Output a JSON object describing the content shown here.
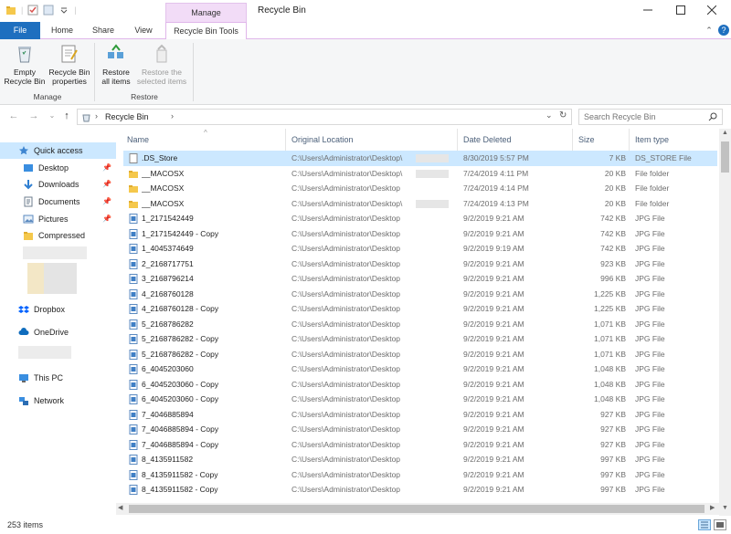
{
  "window": {
    "title": "Recycle Bin",
    "contextual_group": "Manage",
    "minimize_icon": "minimize-icon",
    "maximize_icon": "maximize-icon",
    "close_icon": "close-icon"
  },
  "ribbon": {
    "tabs": [
      {
        "label": "File"
      },
      {
        "label": "Home"
      },
      {
        "label": "Share"
      },
      {
        "label": "View"
      },
      {
        "label": "Recycle Bin Tools"
      }
    ],
    "buttons": {
      "empty": "Empty Recycle Bin",
      "properties": "Recycle Bin properties",
      "restore_all": "Restore all items",
      "restore_selected": "Restore the selected items"
    },
    "groups": {
      "manage": "Manage",
      "restore": "Restore"
    }
  },
  "nav": {
    "address": "Recycle Bin",
    "search_placeholder": "Search Recycle Bin"
  },
  "sidebar": {
    "quick_access": "Quick access",
    "items": [
      {
        "label": "Desktop"
      },
      {
        "label": "Downloads"
      },
      {
        "label": "Documents"
      },
      {
        "label": "Pictures"
      },
      {
        "label": "Compressed"
      }
    ],
    "dropbox": "Dropbox",
    "onedrive": "OneDrive",
    "this_pc": "This PC",
    "network": "Network"
  },
  "columns": {
    "name": "Name",
    "original_location": "Original Location",
    "date_deleted": "Date Deleted",
    "size": "Size",
    "item_type": "Item type"
  },
  "files": [
    {
      "name": ".DS_Store",
      "location": "C:\\Users\\Administrator\\Desktop\\",
      "date": "8/30/2019 5:57 PM",
      "size": "7 KB",
      "type": "DS_STORE File",
      "kind": "file"
    },
    {
      "name": "__MACOSX",
      "location": "C:\\Users\\Administrator\\Desktop\\",
      "date": "7/24/2019 4:11 PM",
      "size": "20 KB",
      "type": "File folder",
      "kind": "folder"
    },
    {
      "name": "__MACOSX",
      "location": "C:\\Users\\Administrator\\Desktop",
      "date": "7/24/2019 4:14 PM",
      "size": "20 KB",
      "type": "File folder",
      "kind": "folder"
    },
    {
      "name": "__MACOSX",
      "location": "C:\\Users\\Administrator\\Desktop\\",
      "date": "7/24/2019 4:13 PM",
      "size": "20 KB",
      "type": "File folder",
      "kind": "folder"
    },
    {
      "name": "1_2171542449",
      "location": "C:\\Users\\Administrator\\Desktop",
      "date": "9/2/2019 9:21 AM",
      "size": "742 KB",
      "type": "JPG File",
      "kind": "jpg"
    },
    {
      "name": "1_2171542449 - Copy",
      "location": "C:\\Users\\Administrator\\Desktop",
      "date": "9/2/2019 9:21 AM",
      "size": "742 KB",
      "type": "JPG File",
      "kind": "jpg"
    },
    {
      "name": "1_4045374649",
      "location": "C:\\Users\\Administrator\\Desktop",
      "date": "9/2/2019 9:19 AM",
      "size": "742 KB",
      "type": "JPG File",
      "kind": "jpg"
    },
    {
      "name": "2_2168717751",
      "location": "C:\\Users\\Administrator\\Desktop",
      "date": "9/2/2019 9:21 AM",
      "size": "923 KB",
      "type": "JPG File",
      "kind": "jpg"
    },
    {
      "name": "3_2168796214",
      "location": "C:\\Users\\Administrator\\Desktop",
      "date": "9/2/2019 9:21 AM",
      "size": "996 KB",
      "type": "JPG File",
      "kind": "jpg"
    },
    {
      "name": "4_2168760128",
      "location": "C:\\Users\\Administrator\\Desktop",
      "date": "9/2/2019 9:21 AM",
      "size": "1,225 KB",
      "type": "JPG File",
      "kind": "jpg"
    },
    {
      "name": "4_2168760128 - Copy",
      "location": "C:\\Users\\Administrator\\Desktop",
      "date": "9/2/2019 9:21 AM",
      "size": "1,225 KB",
      "type": "JPG File",
      "kind": "jpg"
    },
    {
      "name": "5_2168786282",
      "location": "C:\\Users\\Administrator\\Desktop",
      "date": "9/2/2019 9:21 AM",
      "size": "1,071 KB",
      "type": "JPG File",
      "kind": "jpg"
    },
    {
      "name": "5_2168786282 - Copy",
      "location": "C:\\Users\\Administrator\\Desktop",
      "date": "9/2/2019 9:21 AM",
      "size": "1,071 KB",
      "type": "JPG File",
      "kind": "jpg"
    },
    {
      "name": "5_2168786282 - Copy",
      "location": "C:\\Users\\Administrator\\Desktop",
      "date": "9/2/2019 9:21 AM",
      "size": "1,071 KB",
      "type": "JPG File",
      "kind": "jpg"
    },
    {
      "name": "6_4045203060",
      "location": "C:\\Users\\Administrator\\Desktop",
      "date": "9/2/2019 9:21 AM",
      "size": "1,048 KB",
      "type": "JPG File",
      "kind": "jpg"
    },
    {
      "name": "6_4045203060 - Copy",
      "location": "C:\\Users\\Administrator\\Desktop",
      "date": "9/2/2019 9:21 AM",
      "size": "1,048 KB",
      "type": "JPG File",
      "kind": "jpg"
    },
    {
      "name": "6_4045203060 - Copy",
      "location": "C:\\Users\\Administrator\\Desktop",
      "date": "9/2/2019 9:21 AM",
      "size": "1,048 KB",
      "type": "JPG File",
      "kind": "jpg"
    },
    {
      "name": "7_4046885894",
      "location": "C:\\Users\\Administrator\\Desktop",
      "date": "9/2/2019 9:21 AM",
      "size": "927 KB",
      "type": "JPG File",
      "kind": "jpg"
    },
    {
      "name": "7_4046885894 - Copy",
      "location": "C:\\Users\\Administrator\\Desktop",
      "date": "9/2/2019 9:21 AM",
      "size": "927 KB",
      "type": "JPG File",
      "kind": "jpg"
    },
    {
      "name": "7_4046885894 - Copy",
      "location": "C:\\Users\\Administrator\\Desktop",
      "date": "9/2/2019 9:21 AM",
      "size": "927 KB",
      "type": "JPG File",
      "kind": "jpg"
    },
    {
      "name": "8_4135911582",
      "location": "C:\\Users\\Administrator\\Desktop",
      "date": "9/2/2019 9:21 AM",
      "size": "997 KB",
      "type": "JPG File",
      "kind": "jpg"
    },
    {
      "name": "8_4135911582 - Copy",
      "location": "C:\\Users\\Administrator\\Desktop",
      "date": "9/2/2019 9:21 AM",
      "size": "997 KB",
      "type": "JPG File",
      "kind": "jpg"
    },
    {
      "name": "8_4135911582 - Copy",
      "location": "C:\\Users\\Administrator\\Desktop",
      "date": "9/2/2019 9:21 AM",
      "size": "997 KB",
      "type": "JPG File",
      "kind": "jpg"
    }
  ],
  "status": {
    "item_count": "253 items"
  },
  "colors": {
    "file_tab": "#1e6fbf",
    "context_tab": "#f2dcf7",
    "selection": "#cce8ff",
    "folder": "#f5c84c"
  }
}
